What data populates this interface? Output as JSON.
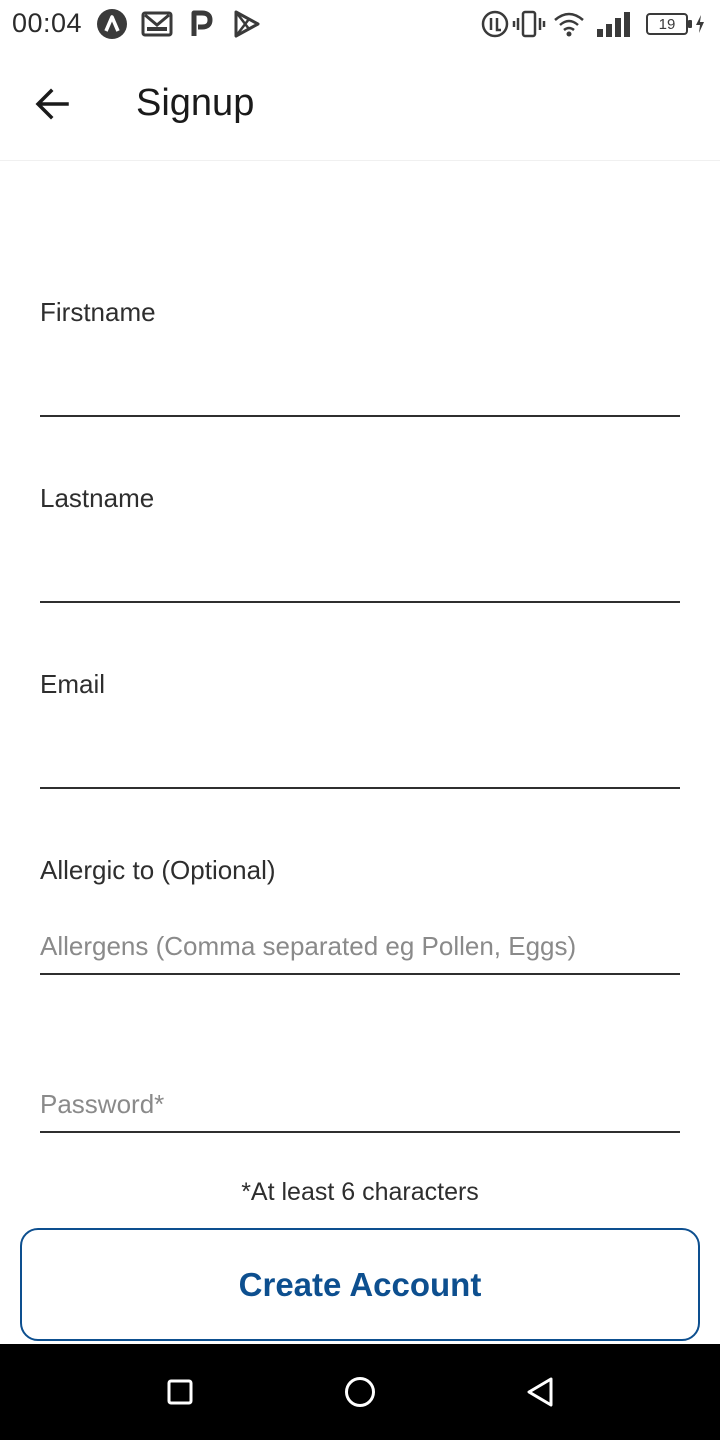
{
  "status_bar": {
    "time": "00:04",
    "battery": "19",
    "icons": [
      "a-app-icon",
      "gmail-icon",
      "p-app-icon",
      "play-store-icon",
      "data-icon",
      "vibrate-icon",
      "wifi-icon",
      "signal-icon",
      "battery-icon",
      "charging-icon"
    ]
  },
  "header": {
    "back_icon": "arrow-back-icon",
    "title": "Signup"
  },
  "form": {
    "firstname_label": "Firstname",
    "firstname_value": "",
    "lastname_label": "Lastname",
    "lastname_value": "",
    "email_label": "Email",
    "email_value": "",
    "allergy_label": "Allergic to (Optional)",
    "allergy_placeholder": "Allergens (Comma separated eg Pollen, Eggs)",
    "password_placeholder": "Password*",
    "password_hint": "*At least 6 characters",
    "submit_label": "Create Account"
  },
  "nav_bar": {
    "icons": [
      "recents-square-icon",
      "home-circle-icon",
      "back-triangle-icon"
    ]
  },
  "colors": {
    "accent": "#0d4f8f",
    "nav_background": "#000000"
  }
}
